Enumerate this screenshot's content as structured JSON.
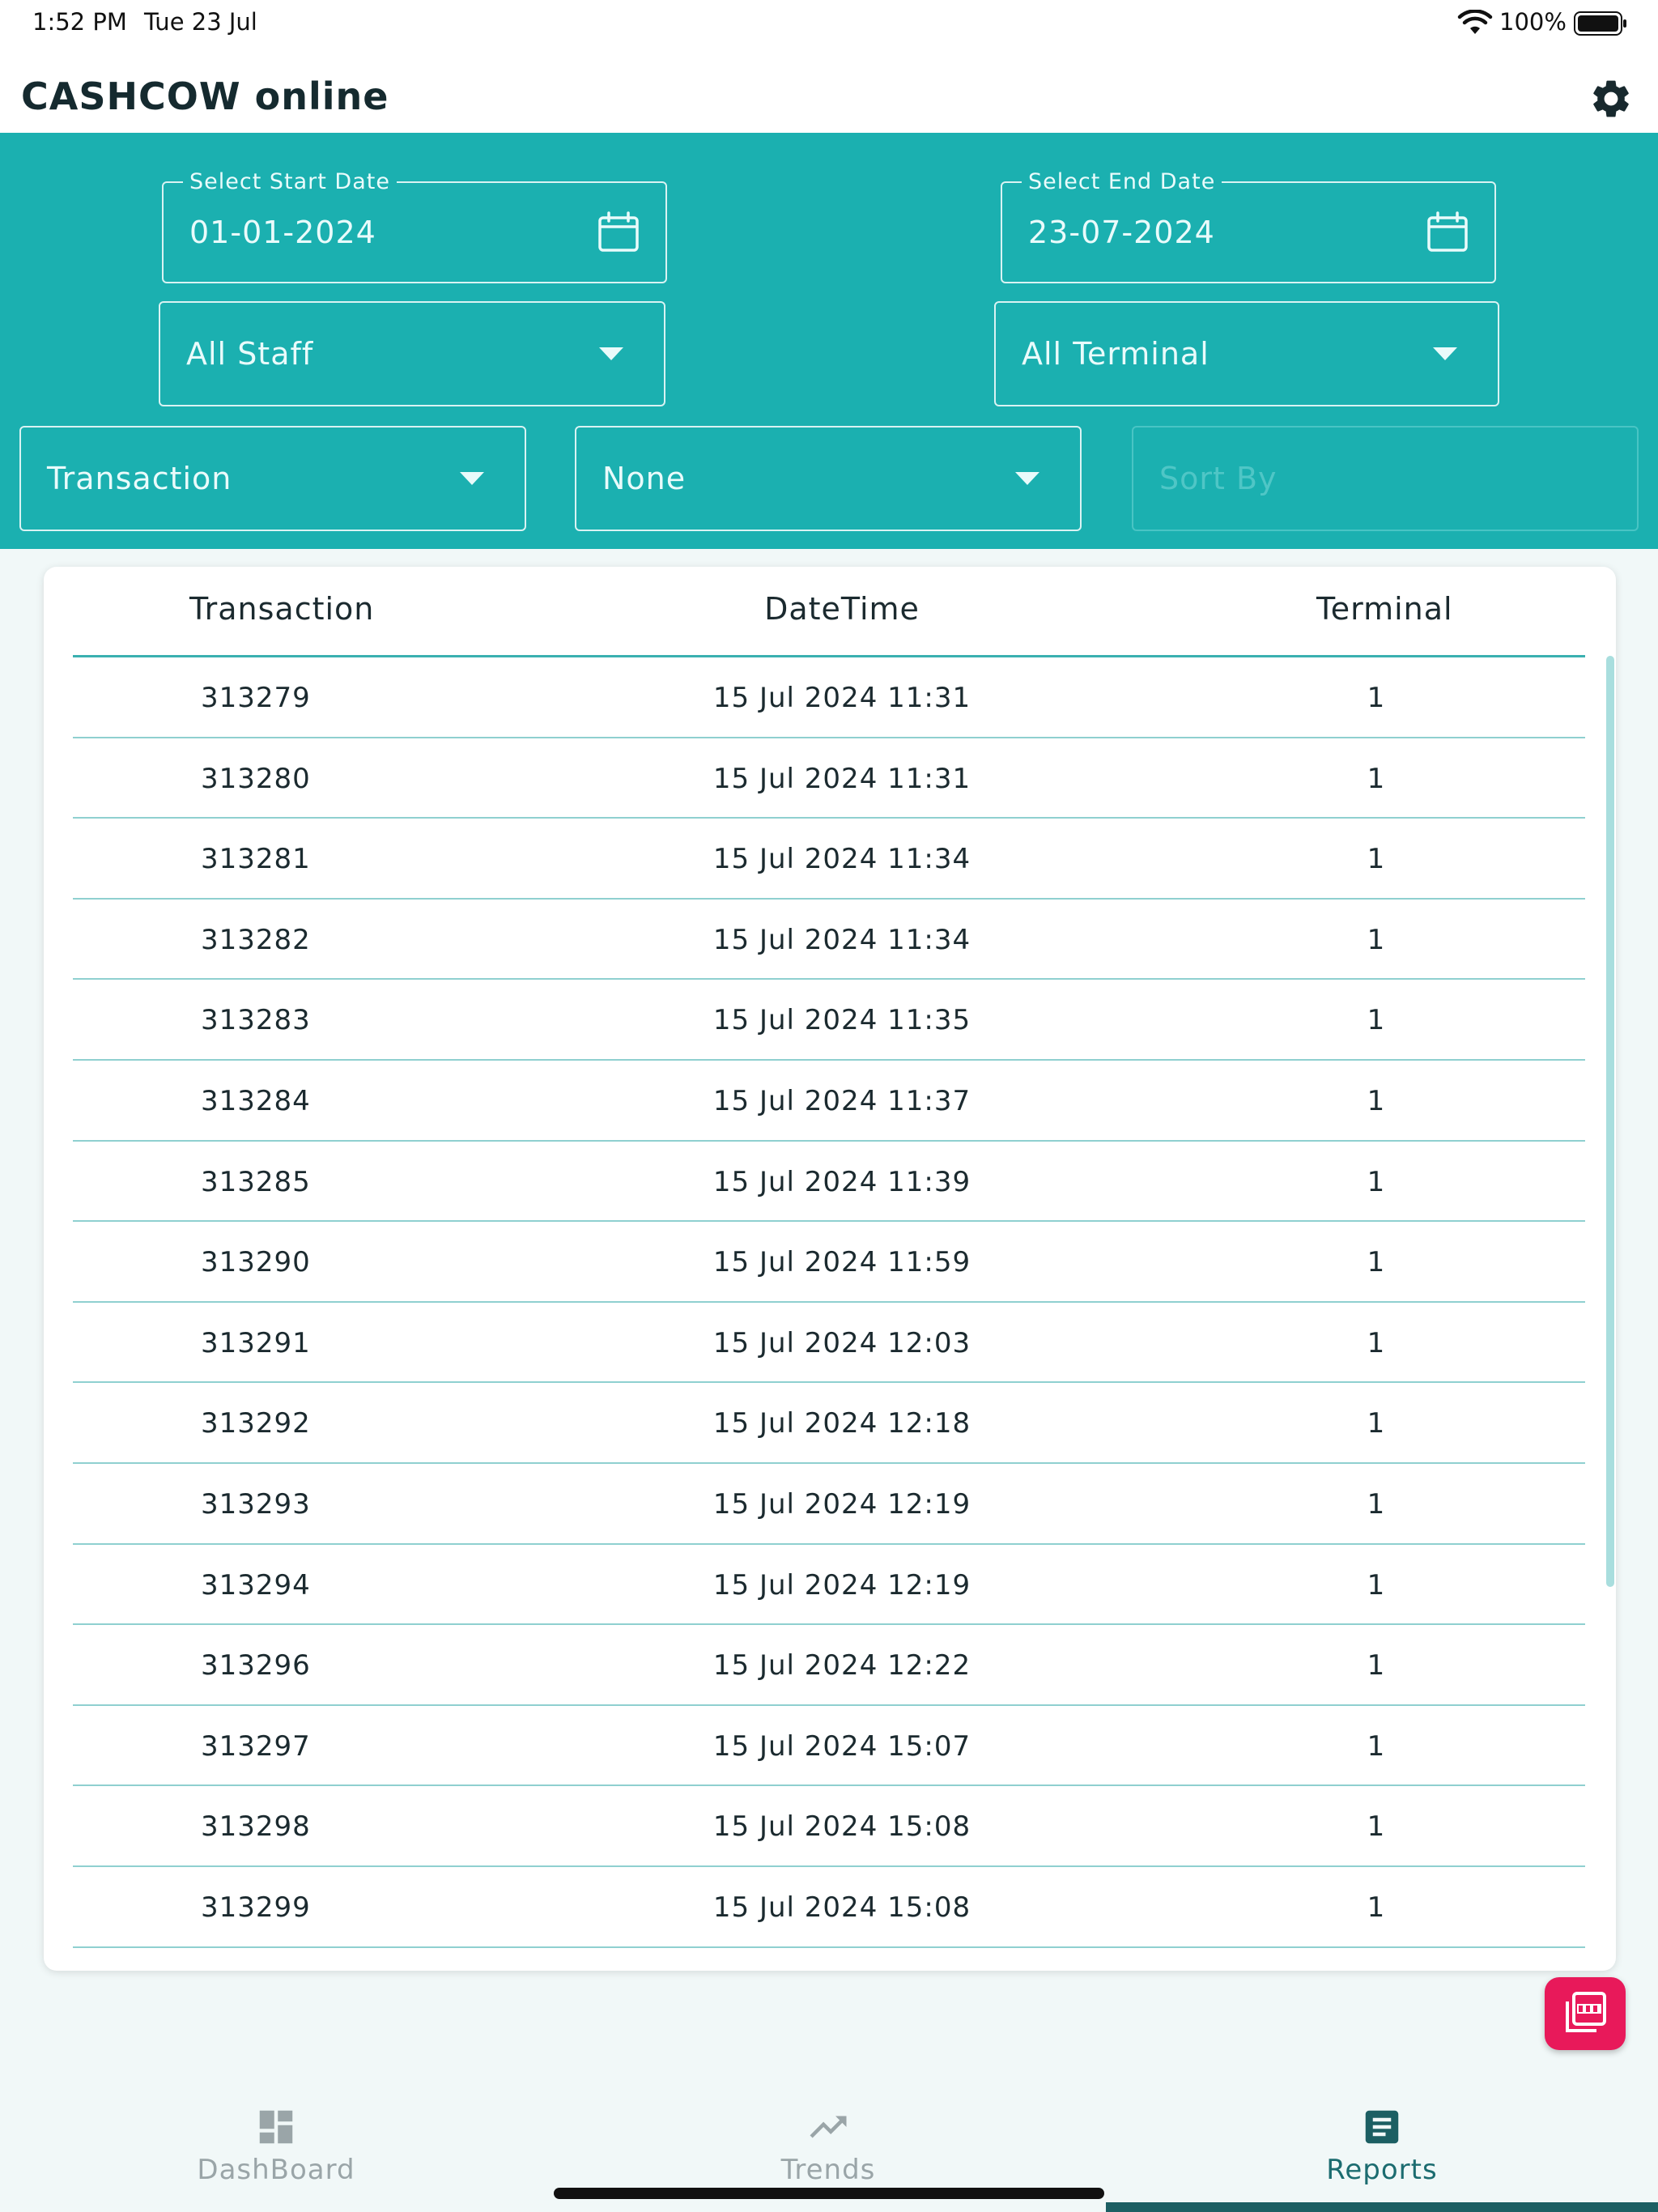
{
  "status_bar": {
    "time": "1:52 PM",
    "date": "Tue 23 Jul",
    "battery": "100%"
  },
  "app": {
    "title": "CASHCOW online"
  },
  "filters": {
    "start_date": {
      "label": "Select Start Date",
      "value": "01-01-2024"
    },
    "end_date": {
      "label": "Select End Date",
      "value": "23-07-2024"
    },
    "staff": "All Staff",
    "terminal": "All Terminal",
    "report_type": "Transaction",
    "group": "None",
    "sort_placeholder": "Sort By"
  },
  "table": {
    "headers": [
      "Transaction",
      "DateTime",
      "Terminal"
    ],
    "rows": [
      [
        "313279",
        "15 Jul 2024 11:31",
        "1"
      ],
      [
        "313280",
        "15 Jul 2024 11:31",
        "1"
      ],
      [
        "313281",
        "15 Jul 2024 11:34",
        "1"
      ],
      [
        "313282",
        "15 Jul 2024 11:34",
        "1"
      ],
      [
        "313283",
        "15 Jul 2024 11:35",
        "1"
      ],
      [
        "313284",
        "15 Jul 2024 11:37",
        "1"
      ],
      [
        "313285",
        "15 Jul 2024 11:39",
        "1"
      ],
      [
        "313290",
        "15 Jul 2024 11:59",
        "1"
      ],
      [
        "313291",
        "15 Jul 2024 12:03",
        "1"
      ],
      [
        "313292",
        "15 Jul 2024 12:18",
        "1"
      ],
      [
        "313293",
        "15 Jul 2024 12:19",
        "1"
      ],
      [
        "313294",
        "15 Jul 2024 12:19",
        "1"
      ],
      [
        "313296",
        "15 Jul 2024 12:22",
        "1"
      ],
      [
        "313297",
        "15 Jul 2024 15:07",
        "1"
      ],
      [
        "313298",
        "15 Jul 2024 15:08",
        "1"
      ],
      [
        "313299",
        "15 Jul 2024 15:08",
        "1"
      ]
    ]
  },
  "nav": {
    "items": [
      {
        "label": "DashBoard",
        "icon": "dashboard-icon"
      },
      {
        "label": "Trends",
        "icon": "trending-up-icon"
      },
      {
        "label": "Reports",
        "icon": "article-icon"
      }
    ],
    "active": "Reports"
  },
  "colors": {
    "accent": "#1bb0b0",
    "fab": "#e8195a",
    "nav_active": "#1c6c70"
  }
}
